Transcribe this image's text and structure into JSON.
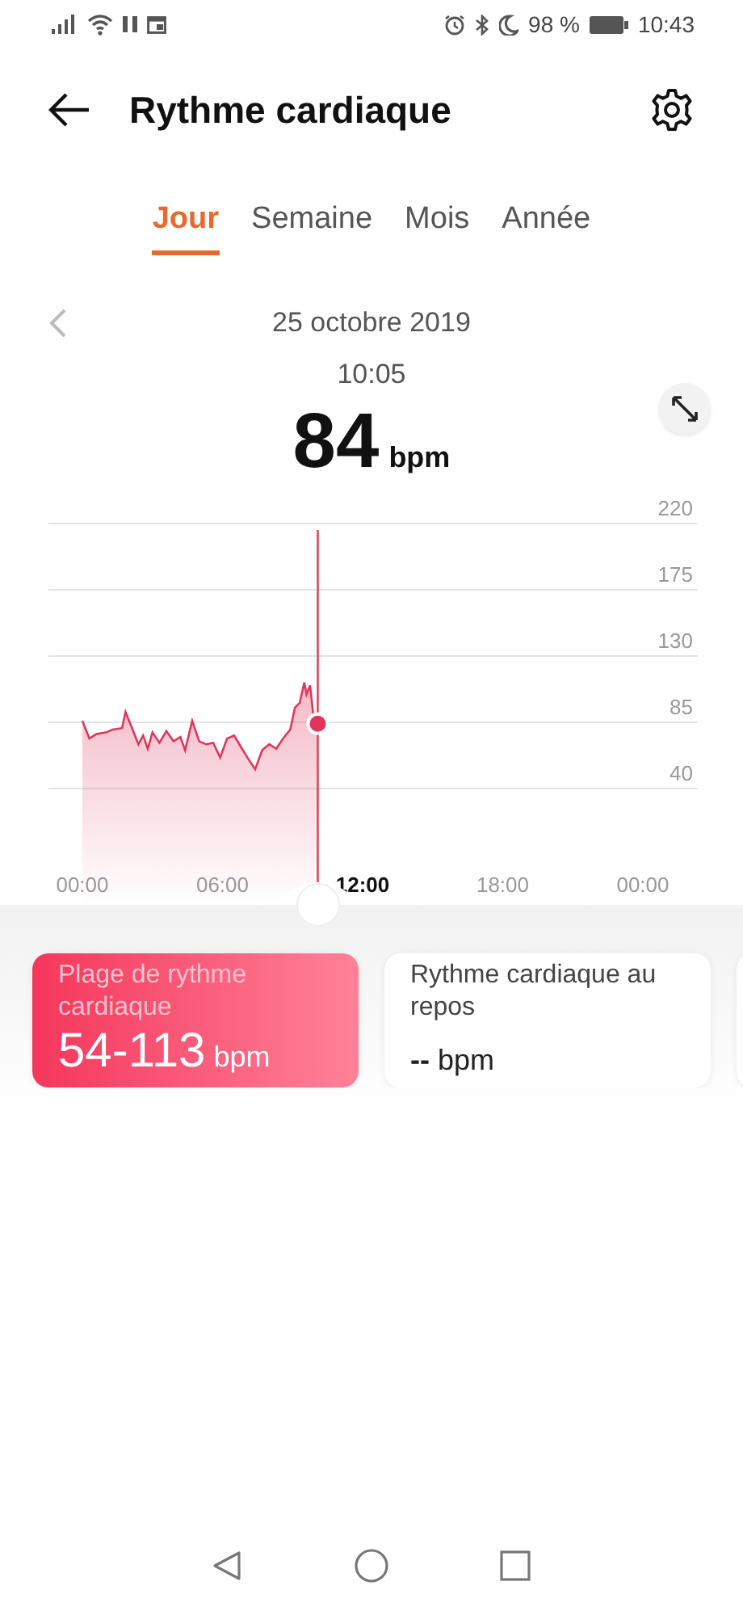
{
  "status_bar": {
    "battery": "98 %",
    "time": "10:43"
  },
  "header": {
    "title": "Rythme cardiaque"
  },
  "tabs": [
    {
      "label": "Jour",
      "selected": true
    },
    {
      "label": "Semaine",
      "selected": false
    },
    {
      "label": "Mois",
      "selected": false
    },
    {
      "label": "Année",
      "selected": false
    }
  ],
  "date": "25 octobre 2019",
  "reading": {
    "time": "10:05",
    "value": "84",
    "unit": "bpm"
  },
  "chart_data": {
    "type": "area",
    "ylim": [
      0,
      220
    ],
    "xlim": [
      0,
      24
    ],
    "yticks": [
      40,
      85,
      130,
      175,
      220
    ],
    "xticks": [
      {
        "value": 0,
        "label": "00:00"
      },
      {
        "value": 6,
        "label": "06:00"
      },
      {
        "value": 12,
        "label": "12:00"
      },
      {
        "value": 18,
        "label": "18:00"
      },
      {
        "value": 24,
        "label": "00:00"
      }
    ],
    "x": [
      0,
      0.3,
      0.6,
      1.0,
      1.3,
      1.7,
      1.85,
      2.1,
      2.4,
      2.6,
      2.8,
      3.0,
      3.3,
      3.6,
      3.9,
      4.2,
      4.4,
      4.7,
      5.0,
      5.3,
      5.6,
      5.9,
      6.2,
      6.5,
      6.8,
      7.1,
      7.4,
      7.7,
      8.0,
      8.3,
      8.6,
      8.9,
      9.1,
      9.3,
      9.5,
      9.6,
      9.75,
      9.9,
      10.08
    ],
    "grid": true,
    "ref_lines": [
      {
        "axis": "x",
        "value": 10.08
      }
    ],
    "series": [
      {
        "color": "#e0365c",
        "values": [
          86,
          74,
          77,
          78,
          80,
          81,
          92,
          82,
          70,
          76,
          67,
          78,
          71,
          79,
          72,
          75,
          66,
          86,
          72,
          70,
          71,
          61,
          74,
          76,
          68,
          60,
          53,
          66,
          70,
          67,
          74,
          80,
          95,
          98,
          112,
          104,
          110,
          88,
          84
        ]
      }
    ]
  },
  "cards": [
    {
      "title": "Plage de rythme cardiaque",
      "value": "54-113",
      "unit": "bpm",
      "selected": true
    },
    {
      "title": "Rythme cardiaque au repos",
      "value": "--",
      "unit": "bpm",
      "selected": false
    }
  ]
}
